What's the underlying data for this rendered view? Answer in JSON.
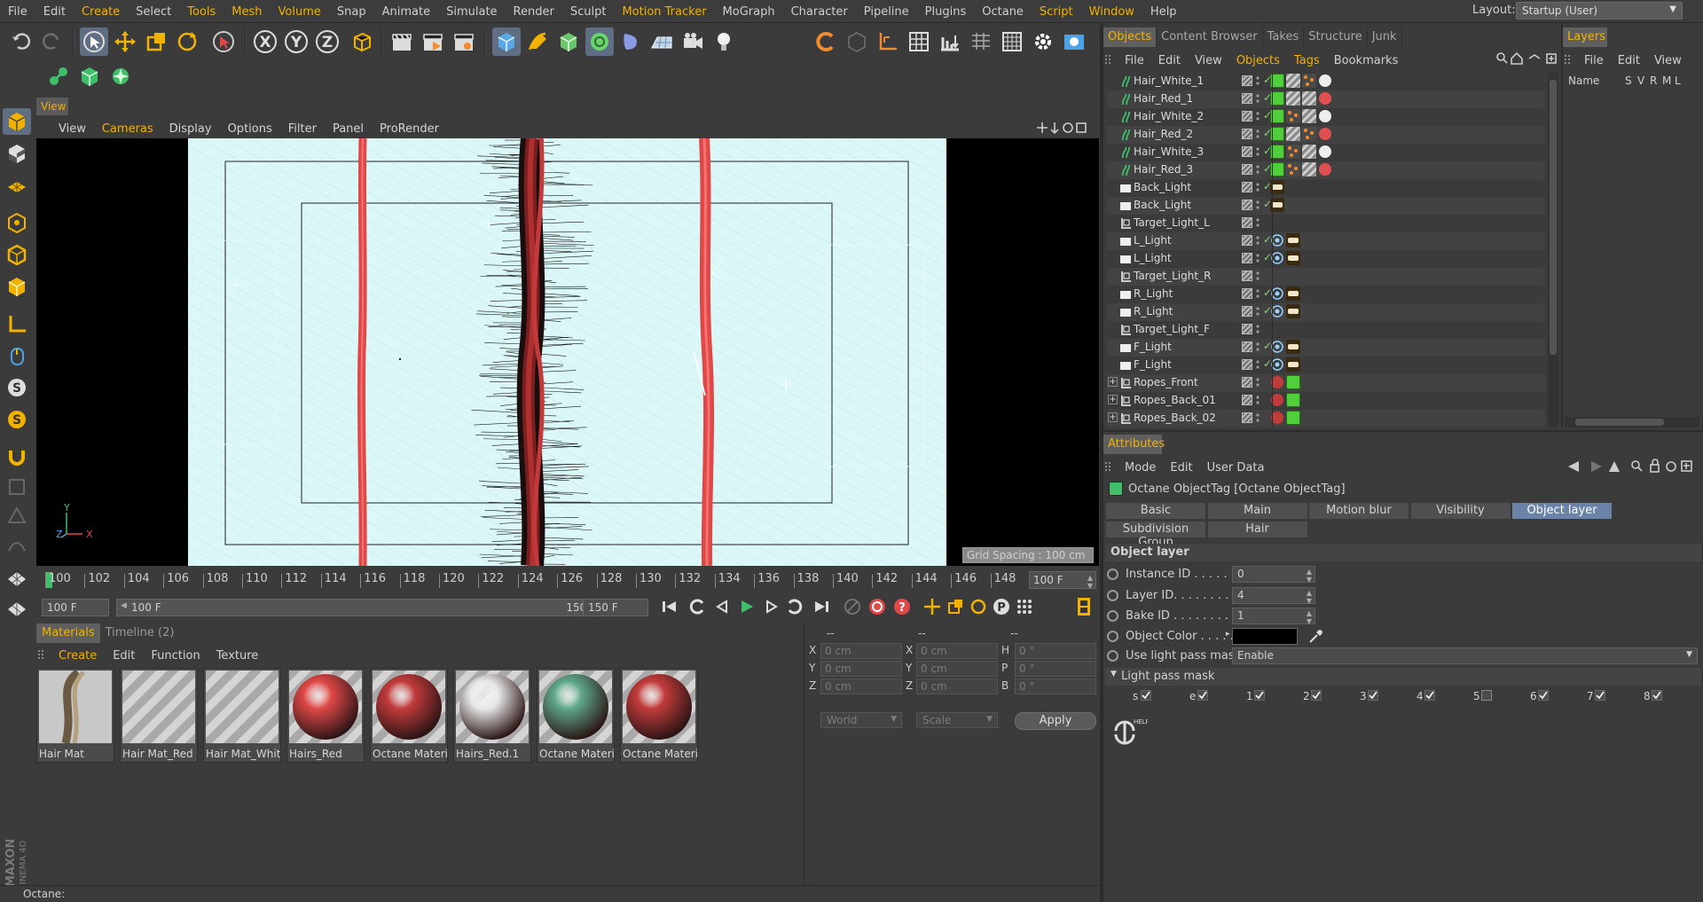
{
  "menubar": {
    "items": [
      "File",
      "Edit",
      "Create",
      "Select",
      "Tools",
      "Mesh",
      "Volume",
      "Snap",
      "Animate",
      "Simulate",
      "Render",
      "Sculpt",
      "Motion Tracker",
      "MoGraph",
      "Character",
      "Pipeline",
      "Plugins",
      "Octane",
      "Script",
      "Window",
      "Help"
    ],
    "layout_label": "Layout:",
    "layout_value": "Startup (User)"
  },
  "toolbar": {
    "axis_x": "X",
    "axis_y": "Y",
    "axis_z": "Z"
  },
  "view": {
    "tab": "View",
    "menu": [
      "View",
      "Cameras",
      "Display",
      "Options",
      "Filter",
      "Panel",
      "ProRender"
    ],
    "grid_spacing": "Grid Spacing : 100 cm",
    "axis_y": "Y",
    "axis_z": "Z",
    "axis_x": "X"
  },
  "timeline": {
    "ticks": [
      "100",
      "102",
      "104",
      "106",
      "108",
      "110",
      "112",
      "114",
      "116",
      "118",
      "120",
      "122",
      "124",
      "126",
      "128",
      "130",
      "132",
      "134",
      "136",
      "138",
      "140",
      "142",
      "144",
      "146",
      "148",
      "150"
    ],
    "current_frame": "100 F",
    "start": "100 F",
    "range_start": "100 F",
    "range_end": "150 F",
    "end": "150 F"
  },
  "materials": {
    "tabs": [
      "Materials",
      "Timeline (2)"
    ],
    "menu": [
      "Create",
      "Edit",
      "Function",
      "Texture"
    ],
    "items": [
      {
        "label": "Hair Mat",
        "kind": "hair"
      },
      {
        "label": "Hair Mat_Red",
        "kind": "stripe"
      },
      {
        "label": "Hair Mat_White",
        "kind": "stripe"
      },
      {
        "label": "Hairs_Red",
        "kind": "sphere",
        "color": "#e04848"
      },
      {
        "label": "Octane Materia",
        "kind": "sphere",
        "color": "#c23b3b"
      },
      {
        "label": "Hairs_Red.1",
        "kind": "sphere",
        "color": "#e9e9e9"
      },
      {
        "label": "Octane Materia",
        "kind": "sphere",
        "color": "#5fa88a"
      },
      {
        "label": "Octane Materia",
        "kind": "sphere",
        "color": "#c23b3b"
      }
    ]
  },
  "coords": {
    "headers": [
      "--",
      "--",
      "--"
    ],
    "rows": [
      {
        "a": "X",
        "av": "0 cm",
        "b": "X",
        "bv": "0 cm",
        "c": "H",
        "cv": "0 °"
      },
      {
        "a": "Y",
        "av": "0 cm",
        "b": "Y",
        "bv": "0 cm",
        "c": "P",
        "cv": "0 °"
      },
      {
        "a": "Z",
        "av": "0 cm",
        "b": "Z",
        "bv": "0 cm",
        "c": "B",
        "cv": "0 °"
      }
    ],
    "mode": "World",
    "scale": "Scale",
    "apply": "Apply"
  },
  "status": "Octane:",
  "objects": {
    "tabs": [
      "Objects",
      "Content Browser",
      "Takes",
      "Structure",
      "Junk"
    ],
    "menu": [
      "File",
      "Edit",
      "View",
      "Objects",
      "Tags",
      "Bookmarks"
    ],
    "rows": [
      {
        "name": "Hair_White_1",
        "type": "hair",
        "check": true,
        "tags": [
          "green",
          "stripe",
          "dots",
          "white"
        ]
      },
      {
        "name": "Hair_Red_1",
        "type": "hair",
        "check": true,
        "tags": [
          "green",
          "stripe",
          "stripe",
          "red"
        ]
      },
      {
        "name": "Hair_White_2",
        "type": "hair",
        "check": true,
        "tags": [
          "green",
          "dots",
          "stripe",
          "white"
        ]
      },
      {
        "name": "Hair_Red_2",
        "type": "hair",
        "check": true,
        "tags": [
          "green",
          "stripe",
          "dots",
          "red"
        ]
      },
      {
        "name": "Hair_White_3",
        "type": "hair",
        "check": true,
        "tags": [
          "green",
          "dots",
          "stripe",
          "white"
        ]
      },
      {
        "name": "Hair_Red_3",
        "type": "hair",
        "check": true,
        "tags": [
          "green",
          "dots",
          "stripe",
          "red"
        ]
      },
      {
        "name": "Back_Light",
        "type": "light",
        "check": true,
        "tags": [
          "lamp"
        ]
      },
      {
        "name": "Back_Light",
        "type": "light",
        "check": true,
        "tags": [
          "lamp"
        ]
      },
      {
        "name": "Target_Light_L",
        "type": "null",
        "check": false,
        "tags": []
      },
      {
        "name": "L_Light",
        "type": "light",
        "check": true,
        "tags": [
          "target",
          "lamp"
        ]
      },
      {
        "name": "L_Light",
        "type": "light",
        "check": true,
        "tags": [
          "target",
          "lamp"
        ]
      },
      {
        "name": "Target_Light_R",
        "type": "null",
        "check": false,
        "tags": []
      },
      {
        "name": "R_Light",
        "type": "light",
        "check": true,
        "tags": [
          "target",
          "lamp"
        ]
      },
      {
        "name": "R_Light",
        "type": "light",
        "check": true,
        "tags": [
          "target",
          "lamp"
        ]
      },
      {
        "name": "Target_Light_F",
        "type": "null",
        "check": false,
        "tags": []
      },
      {
        "name": "F_Light",
        "type": "light",
        "check": true,
        "tags": [
          "target",
          "lamp"
        ]
      },
      {
        "name": "F_Light",
        "type": "light",
        "check": true,
        "tags": [
          "target",
          "lamp"
        ]
      },
      {
        "name": "Ropes_Front",
        "type": "group",
        "check": false,
        "tags": [
          "redball",
          "green"
        ]
      },
      {
        "name": "Ropes_Back_01",
        "type": "group",
        "check": false,
        "tags": [
          "redball",
          "green"
        ]
      },
      {
        "name": "Ropes_Back_02",
        "type": "group",
        "check": false,
        "tags": [
          "redball",
          "green"
        ]
      }
    ]
  },
  "layers": {
    "tab": "Layers",
    "menu": [
      "File",
      "Edit",
      "View"
    ],
    "col_name": "Name",
    "cols": [
      "S",
      "V",
      "R",
      "M",
      "L"
    ]
  },
  "attributes": {
    "tab": "Attributes",
    "menu": [
      "Mode",
      "Edit",
      "User Data"
    ],
    "title": "Octane ObjectTag [Octane ObjectTag]",
    "tabs_row1": [
      "Basic",
      "Main",
      "Motion blur",
      "Visibility",
      "Object layer"
    ],
    "tabs_row2": [
      "Subdivision Group",
      "Hair"
    ],
    "active_tab": "Object layer",
    "section": "Object layer",
    "fields": [
      {
        "label": "Instance ID . . . . . . . . .",
        "value": "0"
      },
      {
        "label": "Layer ID. . . . . . . . . . . .",
        "value": "4"
      },
      {
        "label": "Bake ID . . . . . . . . . . . .",
        "value": "1"
      }
    ],
    "object_color_label": "Object Color . . . . . . . .",
    "object_color": "#000000",
    "light_pass_label": "Use light pass mask",
    "light_pass_value": "Enable",
    "light_pass_mask_head": "Light pass mask",
    "mask_items": [
      {
        "k": "s",
        "on": true
      },
      {
        "k": "e",
        "on": true
      },
      {
        "k": "1",
        "on": true
      },
      {
        "k": "2",
        "on": true
      },
      {
        "k": "3",
        "on": true
      },
      {
        "k": "4",
        "on": true
      },
      {
        "k": "5",
        "on": false
      },
      {
        "k": "6",
        "on": true
      },
      {
        "k": "7",
        "on": true
      },
      {
        "k": "8",
        "on": true
      }
    ],
    "help_label": "HELP"
  },
  "colors": {
    "accent": "#f2b200",
    "selected_tab": "#6b83a6",
    "panel": "#3b3b3b",
    "viewport_bg": "#dbf6f6",
    "rope_red": "#e04848"
  }
}
